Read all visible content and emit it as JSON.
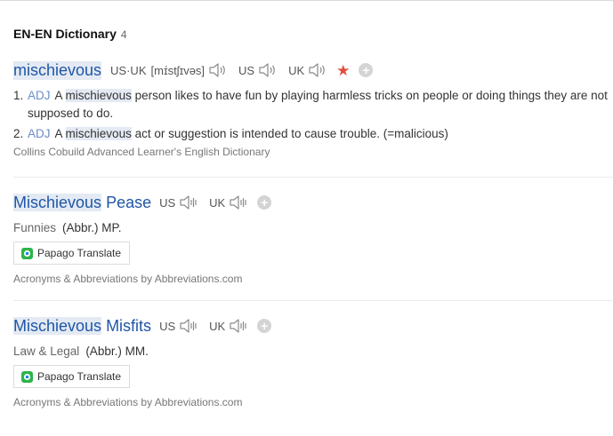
{
  "header": {
    "title": "EN-EN Dictionary",
    "count": "4"
  },
  "entries": [
    {
      "headword": "mischievous",
      "pron_label": "US·UK",
      "phonetic": "[mɪ́stʃɪvəs]",
      "accent_us": "US",
      "accent_uk": "UK",
      "star": "★",
      "definitions": [
        {
          "num": "1.",
          "pos": "ADJ",
          "pre": "A",
          "hl": "mischievous",
          "rest": "person likes to have fun by playing harmless tricks on people or doing things they are not supposed to do."
        },
        {
          "num": "2.",
          "pos": "ADJ",
          "pre": "A",
          "hl": "mischievous",
          "rest": "act or suggestion is intended to cause trouble. (=malicious)"
        }
      ],
      "source": "Collins Cobuild Advanced Learner's English Dictionary"
    },
    {
      "headword_hl": "Mischievous",
      "headword_rest": "Pease",
      "accent_us": "US",
      "accent_uk": "UK",
      "category": "Funnies",
      "abbr": "(Abbr.) MP.",
      "translate_label": "Papago Translate",
      "source": "Acronyms & Abbreviations by Abbreviations.com"
    },
    {
      "headword_hl": "Mischievous",
      "headword_rest": "Misfits",
      "accent_us": "US",
      "accent_uk": "UK",
      "category": "Law & Legal",
      "abbr": "(Abbr.) MM.",
      "translate_label": "Papago Translate",
      "source": "Acronyms & Abbreviations by Abbreviations.com"
    }
  ],
  "colors": {
    "link": "#1f56a6",
    "pos": "#6a8dc4",
    "star": "#e54b3c",
    "highlight": "#e4eaf3"
  },
  "icons": {
    "speaker": "speaker-icon",
    "plus": "add-wordbook-icon",
    "papago": "papago-icon"
  }
}
